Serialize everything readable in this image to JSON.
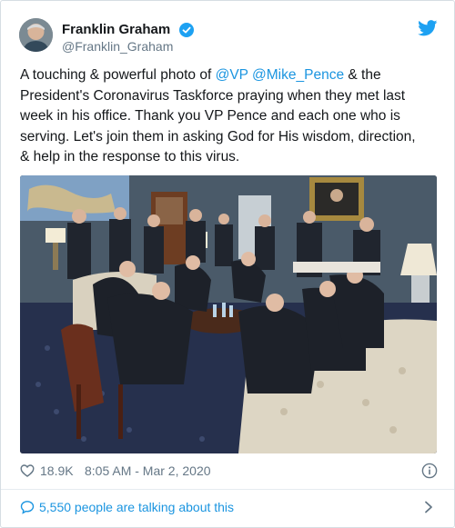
{
  "author": {
    "name": "Franklin Graham",
    "handle": "@Franklin_Graham"
  },
  "tweet": {
    "lines": [
      {
        "t1": "A touching & powerful photo of ",
        "m1": "@VP",
        "sp": " ",
        "m2": "@Mike_Pence",
        "t2": " & the"
      },
      {
        "text": "President's Coronavirus Taskforce praying when they met last"
      },
      {
        "text": "week in his office. Thank you VP Pence and each one who is"
      },
      {
        "text": "serving. Let's join them in asking God for His wisdom, direction,"
      },
      {
        "text": "& help in the response to this virus."
      }
    ]
  },
  "meta": {
    "likes": "18.9K",
    "timestamp": "8:05 AM - Mar 2, 2020"
  },
  "footer": {
    "talking": "5,550 people are talking about this"
  },
  "colors": {
    "link": "#1b95e0",
    "verified": "#1da1f2",
    "secondary_text": "#657786"
  },
  "icons": [
    "verified-badge-icon",
    "twitter-bird-icon",
    "heart-icon",
    "info-icon",
    "speech-bubble-icon",
    "chevron-right-icon"
  ]
}
